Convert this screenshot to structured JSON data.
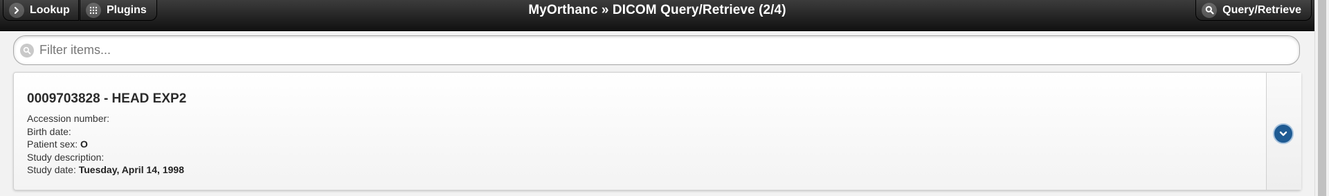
{
  "header": {
    "lookup_label": "Lookup",
    "plugins_label": "Plugins",
    "title": "MyOrthanc » DICOM Query/Retrieve (2/4)",
    "query_retrieve_label": "Query/Retrieve"
  },
  "search": {
    "placeholder": "Filter items..."
  },
  "study": {
    "title": "0009703828 - HEAD EXP2",
    "fields": [
      {
        "label": "Accession number:",
        "value": ""
      },
      {
        "label": "Birth date:",
        "value": ""
      },
      {
        "label": "Patient sex:",
        "value": "O"
      },
      {
        "label": "Study description:",
        "value": ""
      },
      {
        "label": "Study date:",
        "value": "Tuesday, April 14, 1998"
      }
    ]
  },
  "colors": {
    "header_bg": "#1a1a1a",
    "accent_button": "#1f5b93"
  },
  "icons": {
    "lookup": "chevron-right-icon",
    "plugins": "grid-icon",
    "query_retrieve": "search-icon",
    "filter": "search-icon",
    "expand": "chevron-down-icon"
  }
}
